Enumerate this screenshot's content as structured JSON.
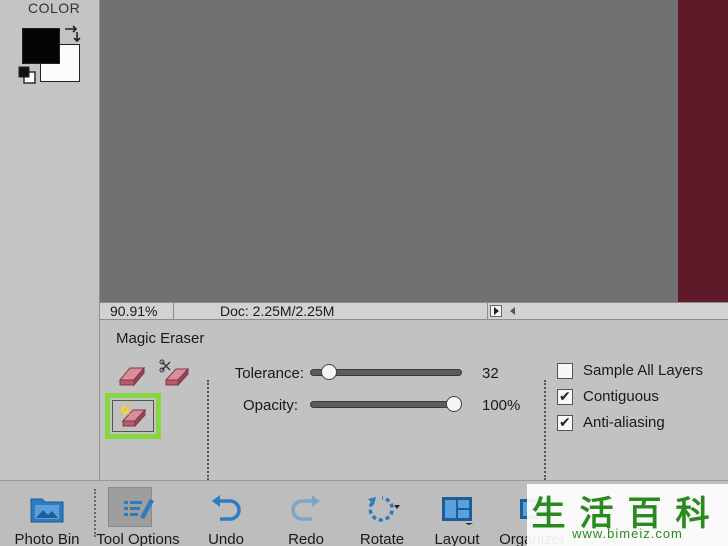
{
  "toolbox": {
    "color_label": "COLOR",
    "foreground_color": "#050505",
    "background_color": "#fbfbfb"
  },
  "canvas": {
    "background": "#717171",
    "image_strip_color": "#5e1a28"
  },
  "statusbar": {
    "zoom": "90.91%",
    "doc_size": "Doc: 2.25M/2.25M"
  },
  "tool_options": {
    "tool_name": "Magic Eraser",
    "tools": [
      {
        "name": "Eraser Tool",
        "icon": "eraser-icon"
      },
      {
        "name": "Background Eraser Tool",
        "icon": "background-eraser-icon"
      },
      {
        "name": "Magic Eraser Tool",
        "icon": "magic-eraser-icon",
        "selected": true
      }
    ],
    "highlight_color": "#86d640",
    "tolerance": {
      "label": "Tolerance:",
      "value": "32",
      "level": 0.08
    },
    "opacity": {
      "label": "Opacity:",
      "value": "100%",
      "level": 1.0
    },
    "checkboxes": [
      {
        "label": "Sample All Layers",
        "checked": false
      },
      {
        "label": "Contiguous",
        "checked": true
      },
      {
        "label": "Anti-aliasing",
        "checked": true
      }
    ]
  },
  "taskbar": {
    "items": [
      {
        "label": "Photo Bin",
        "icon": "photo-bin-icon"
      },
      {
        "label": "Tool Options",
        "icon": "tool-options-icon",
        "active": true
      },
      {
        "label": "Undo",
        "icon": "undo-icon"
      },
      {
        "label": "Redo",
        "icon": "redo-icon"
      },
      {
        "label": "Rotate",
        "icon": "rotate-icon"
      },
      {
        "label": "Layout",
        "icon": "layout-icon"
      },
      {
        "label": "Organizer",
        "icon": "organizer-icon"
      }
    ]
  },
  "watermark": {
    "text": "生活百科",
    "url": "www.bimeiz.com"
  }
}
